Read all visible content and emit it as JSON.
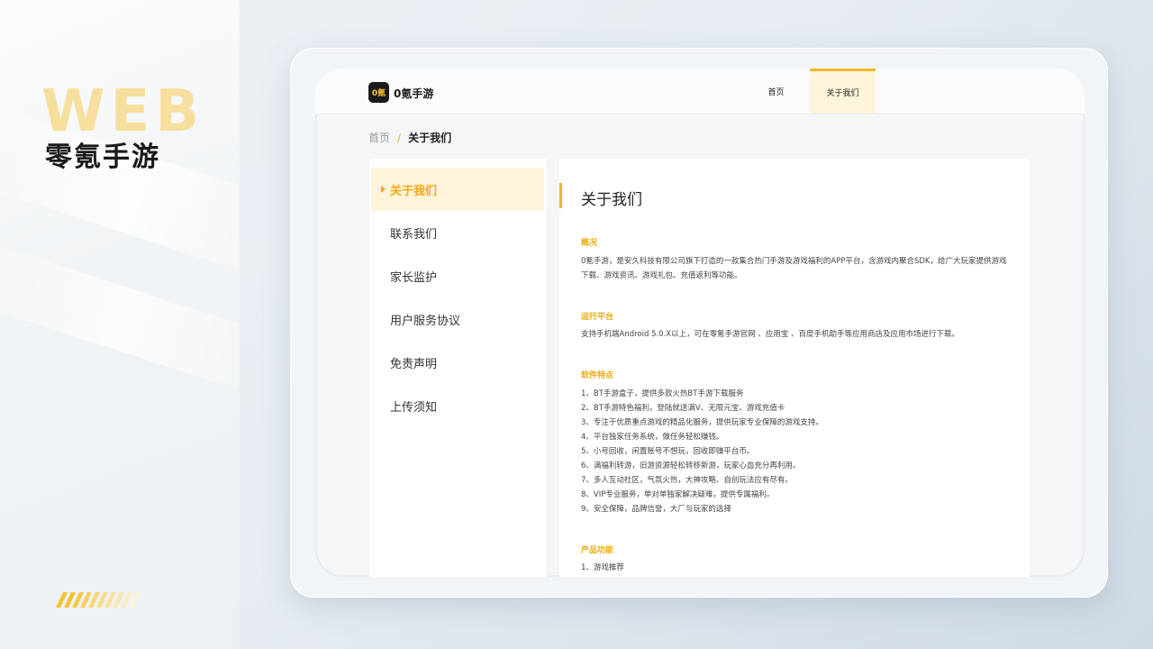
{
  "showcase": {
    "web_label": "WEB",
    "brand_name": "零氪手游",
    "stripe_colors": [
      "#f4c330",
      "#f4c330",
      "#f5c94a",
      "#f6cf5e",
      "#f7d572",
      "#f8db86",
      "#f9e19a",
      "#fae7ae",
      "#fbedc2",
      "#fcf3d6"
    ]
  },
  "app": {
    "logo_mark": "0氪",
    "logo_text": "0氪手游",
    "nav": {
      "home": "首页",
      "about": "关于我们"
    }
  },
  "breadcrumb": {
    "home": "首页",
    "separator": "/",
    "current": "关于我们"
  },
  "sidebar": {
    "items": [
      {
        "label": "关于我们"
      },
      {
        "label": "联系我们"
      },
      {
        "label": "家长监护"
      },
      {
        "label": "用户服务协议"
      },
      {
        "label": "免责声明"
      },
      {
        "label": "上传须知"
      }
    ]
  },
  "content": {
    "title": "关于我们",
    "overview": {
      "heading": "概况",
      "text": "0氪手游，是安久科技有限公司旗下打造的一款集合热门手游及游戏福利的APP平台，含游戏内聚合SDK，给广大玩家提供游戏下载、游戏资讯、游戏礼包、充值返利等功能。"
    },
    "platform": {
      "heading": "运行平台",
      "text": "支持手机端Android 5.0.X以上，可在零氪手游官网 、应用宝 、百度手机助手等应用商店及应用市场进行下载。"
    },
    "features": {
      "heading": "软件特点",
      "items": [
        "1、BT手游盒子，提供多款火热BT手游下载服务",
        "2、BT手游特色福利，登陆就送满V、无限元宝、游戏充值卡",
        "3、专注于优质重点游戏的精品化服务，提供玩家专业保障的游戏支持。",
        "4、平台独家任务系统，做任务轻松赚钱。",
        "5、小号回收，闲置账号不想玩，回收即赚平台币。",
        "6、满福利转游，旧游资源轻松转移新游，玩家心血充分再利用。",
        "7、多人互动社区，气氛火热，大神攻略、自创玩法应有尽有。",
        "8、VIP专业服务，单对单独家解决疑难，提供专属福利。",
        "9、安全保障，品牌信誉，大厂与玩家的选择"
      ]
    },
    "functions": {
      "heading": "产品功能",
      "items": [
        "1、游戏推荐"
      ]
    }
  }
}
